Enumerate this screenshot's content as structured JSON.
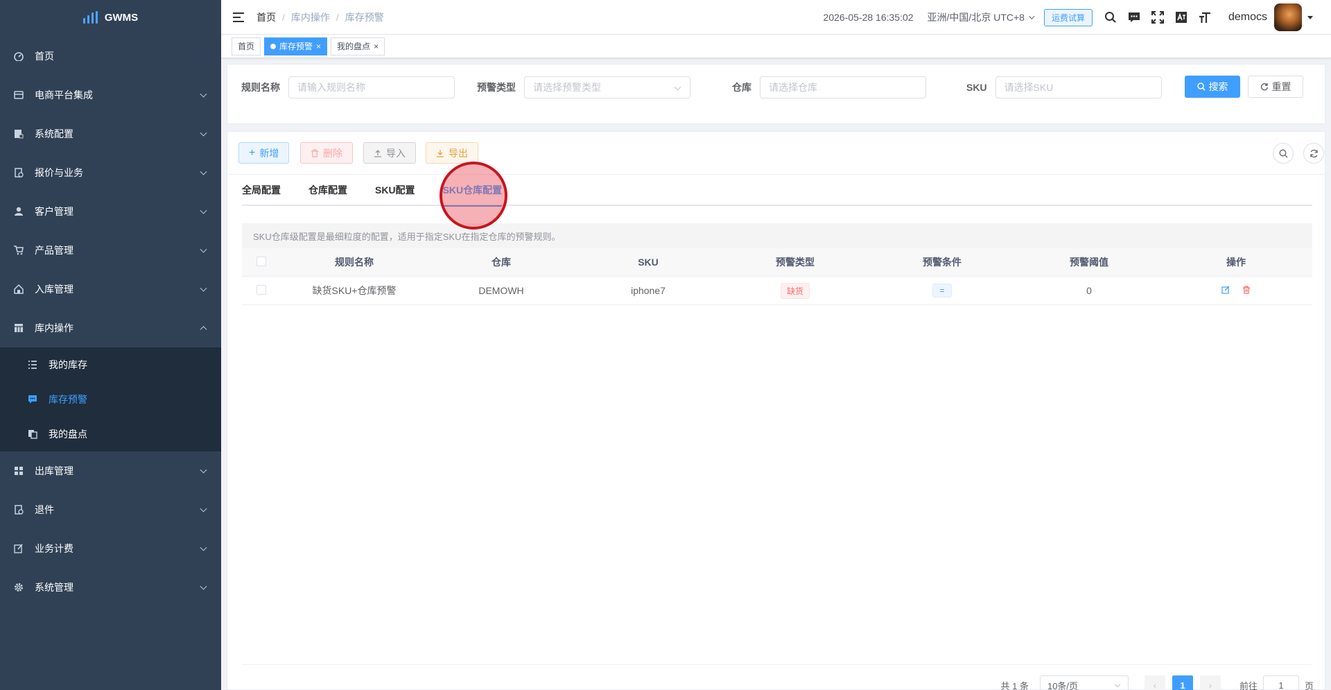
{
  "app": {
    "name": "GWMS"
  },
  "sidebar": {
    "items": [
      {
        "label": "首页",
        "icon": "dashboard-icon"
      },
      {
        "label": "电商平台集成",
        "icon": "store-icon"
      },
      {
        "label": "系统配置",
        "icon": "config-icon"
      },
      {
        "label": "报价与业务",
        "icon": "quote-icon"
      },
      {
        "label": "客户管理",
        "icon": "user-icon"
      },
      {
        "label": "产品管理",
        "icon": "cart-icon"
      },
      {
        "label": "入库管理",
        "icon": "home-icon"
      },
      {
        "label": "库内操作",
        "icon": "table-icon"
      }
    ],
    "submenu": [
      {
        "label": "我的库存",
        "icon": "list-icon"
      },
      {
        "label": "库存预警",
        "icon": "message-icon"
      },
      {
        "label": "我的盘点",
        "icon": "copy-icon"
      }
    ],
    "items_after": [
      {
        "label": "出库管理",
        "icon": "grid-icon"
      },
      {
        "label": "退件",
        "icon": "return-icon"
      },
      {
        "label": "业务计费",
        "icon": "edit-icon"
      },
      {
        "label": "系统管理",
        "icon": "gear-icon"
      }
    ]
  },
  "header": {
    "breadcrumb": [
      "首页",
      "库内操作",
      "库存预警"
    ],
    "datetime": "2026-05-28 16:35:02",
    "timezone": "亚洲/中国/北京 UTC+8",
    "freight_button": "运费试算",
    "username": "democs"
  },
  "tags": [
    {
      "label": "首页"
    },
    {
      "label": "库存预警"
    },
    {
      "label": "我的盘点"
    }
  ],
  "search": {
    "rule_name_label": "规则名称",
    "rule_name_placeholder": "请输入规则名称",
    "alert_type_label": "预警类型",
    "alert_type_placeholder": "请选择预警类型",
    "warehouse_label": "仓库",
    "warehouse_placeholder": "请选择仓库",
    "sku_label": "SKU",
    "sku_placeholder": "请选择SKU",
    "search_button": "搜索",
    "reset_button": "重置"
  },
  "toolbar": {
    "add": "新增",
    "delete": "删除",
    "import": "导入",
    "export": "导出"
  },
  "tabs": [
    "全局配置",
    "仓库配置",
    "SKU配置",
    "SKU仓库配置"
  ],
  "note": "SKU仓库级配置是最细粒度的配置，适用于指定SKU在指定仓库的预警规则。",
  "table": {
    "columns": [
      "规则名称",
      "仓库",
      "SKU",
      "预警类型",
      "预警条件",
      "预警阈值",
      "操作"
    ],
    "rows": [
      {
        "rule_name": "缺货SKU+仓库预警",
        "warehouse": "DEMOWH",
        "sku": "iphone7",
        "alert_type": "缺货",
        "condition": "=",
        "threshold": "0"
      }
    ]
  },
  "pagination": {
    "total": "共 1 条",
    "page_size": "10条/页",
    "current_page": "1",
    "goto_label": "前往",
    "goto_value": "1",
    "page_suffix": "页"
  },
  "colors": {
    "primary": "#409eff",
    "sidebar_bg": "#304156",
    "submenu_bg": "#1f2d3d",
    "danger": "#f56c6c",
    "warning": "#e6a23c"
  }
}
